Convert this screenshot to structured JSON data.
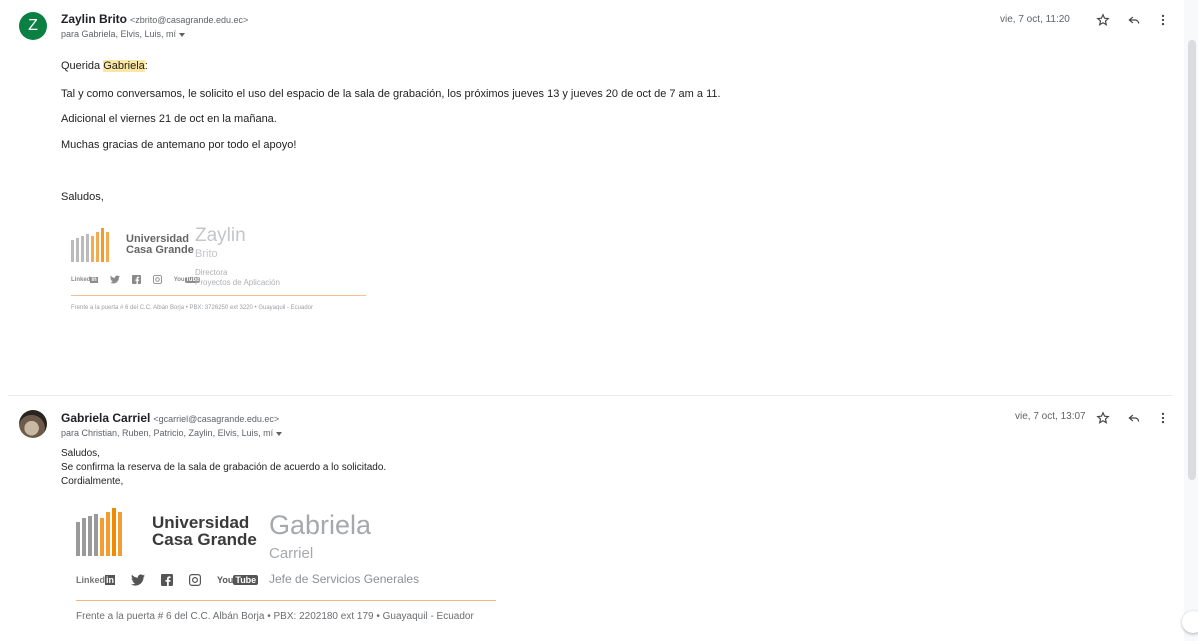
{
  "messages": [
    {
      "avatar_letter": "Z",
      "sender_name": "Zaylin Brito",
      "sender_email": "<zbrito@casagrande.edu.ec>",
      "recipients": "para Gabriela, Elvis, Luis, mí",
      "date": "vie, 7 oct, 11:20",
      "greeting_prefix": "Querida ",
      "greeting_name": "Gabriela",
      "greeting_suffix": ":",
      "lines": [
        "Tal y como conversamos, le solicito el uso del espacio de la sala de grabación, los próximos jueves 13 y jueves 20 de oct de 7 am a 11.",
        "Adicional el viernes 21 de oct en la mañana.",
        "Muchas gracias de antemano por todo el apoyo!"
      ],
      "closing": "Saludos,",
      "signature": {
        "uni_line1": "Universidad",
        "uni_line2": "Casa Grande",
        "first_name": "Zaylin",
        "last_name": "Brito",
        "role_line1": "Directora",
        "role_line2": "Proyectos de Aplicación",
        "social": [
          "Linked",
          "in",
          "YouTube"
        ],
        "address": "Frente a la puerta # 6 del C.C. Albán Borja  •  PBX: 3726250 ext 3220  •  Guayaquil - Ecuador"
      }
    },
    {
      "sender_name": "Gabriela Carriel",
      "sender_email": "<gcarriel@casagrande.edu.ec>",
      "recipients": "para Christian, Ruben, Patricio, Zaylin, Elvis, Luis, mí",
      "date": "vie, 7 oct, 13:07",
      "lines": [
        "Saludos,",
        "Se confirma la reserva de la sala de grabación de acuerdo a lo solicitado.",
        "Cordialmente,"
      ],
      "signature": {
        "uni_line1": "Universidad",
        "uni_line2": "Casa Grande",
        "first_name": "Gabriela",
        "last_name": "Carriel",
        "role": "Jefe de Servicios Generales",
        "address": "Frente a la puerta # 6 del C.C. Albán Borja  •  PBX: 2202180 ext 179  •  Guayaquil - Ecuador"
      }
    }
  ],
  "icons": [
    "star-icon",
    "reply-icon",
    "more-vert-icon"
  ],
  "colors": {
    "avatar_green": "#0b8043",
    "highlight": "#fbe6a2",
    "logo_orange": "#f08a00",
    "logo_gray": "#9a9a9a",
    "rule_orange": "#f0b77a"
  }
}
